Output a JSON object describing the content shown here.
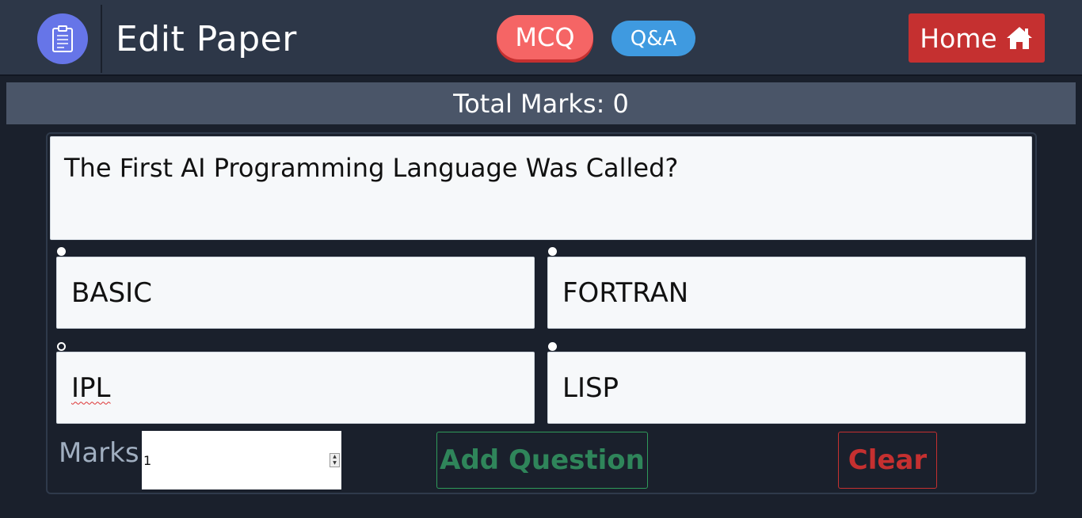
{
  "header": {
    "title": "Edit Paper",
    "tabs": [
      {
        "label": "MCQ"
      },
      {
        "label": "Q&A"
      }
    ],
    "home_label": "Home"
  },
  "summary": {
    "total_marks_text": "Total Marks: 0"
  },
  "form": {
    "question": "The First AI Programming Language Was Called?",
    "options": [
      {
        "label": "BASIC",
        "selected": false
      },
      {
        "label": "FORTRAN",
        "selected": false
      },
      {
        "label": "IPL",
        "selected": true
      },
      {
        "label": "LISP",
        "selected": false
      }
    ],
    "marks_label": "Marks",
    "marks_value": "1",
    "add_label": "Add Question",
    "clear_label": "Clear"
  },
  "colors": {
    "navbar": "#2d3748",
    "logo": "#6675e8",
    "mcq": "#f56565",
    "qa": "#3f9ae0",
    "home": "#c53030",
    "add": "#2f855a",
    "clear": "#c53030"
  },
  "icons": {
    "logo": "clipboard-icon",
    "home": "home-icon"
  }
}
